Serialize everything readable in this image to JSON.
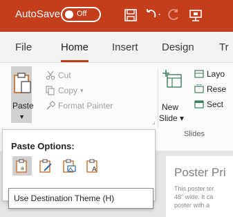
{
  "titlebar": {
    "autosave_label": "AutoSave",
    "autosave_state": "Off",
    "accent_color": "#c43e1c",
    "icons": [
      "save-icon",
      "undo-icon",
      "redo-icon",
      "present-icon"
    ]
  },
  "tabs": [
    {
      "label": "File",
      "active": false
    },
    {
      "label": "Home",
      "active": true
    },
    {
      "label": "Insert",
      "active": false
    },
    {
      "label": "Design",
      "active": false
    },
    {
      "label": "Tr",
      "active": false
    }
  ],
  "clipboard": {
    "paste_label": "Paste",
    "cut_label": "Cut",
    "copy_label": "Copy",
    "format_painter_label": "Format Painter"
  },
  "slides": {
    "new_label": "New",
    "slide_label": "Slide",
    "group_label": "Slides",
    "commands": [
      "Layo",
      "Rese",
      "Sect"
    ]
  },
  "paste_menu": {
    "title": "Paste Options:",
    "options": [
      "use-destination-theme",
      "keep-source-formatting",
      "picture",
      "keep-text-only"
    ],
    "selected_index": 0,
    "tooltip": "Use Destination Theme (H)"
  },
  "slide_preview": {
    "title": "Poster Pri",
    "lines": [
      "This poster ter",
      "48\" wide. It ca",
      "poster with a"
    ]
  }
}
